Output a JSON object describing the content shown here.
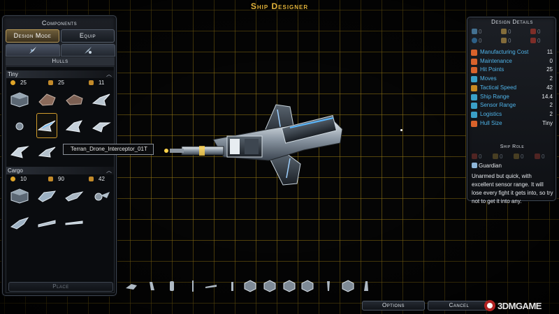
{
  "title": "Ship Designer",
  "components": {
    "header": "Components",
    "tabs": {
      "design_mode": "Design Mode",
      "equip": "Equip"
    },
    "section_label": "Hulls",
    "categories": [
      {
        "name": "Tiny",
        "stats": {
          "cost": "25",
          "capacity": "25",
          "speed": "11"
        }
      },
      {
        "name": "Cargo",
        "stats": {
          "cost": "10",
          "capacity": "90",
          "speed": "42"
        }
      }
    ],
    "tooltip": "Terran_Drone_Interceptor_01T",
    "place_label": "Place"
  },
  "design_details": {
    "header": "Design Details",
    "weapons": [
      "0",
      "0",
      "0",
      "0",
      "0",
      "0"
    ],
    "stats": [
      {
        "label": "Manufacturing Cost",
        "value": "11",
        "icon": "cost-icon",
        "color": "#d9622b"
      },
      {
        "label": "Maintenance",
        "value": "0",
        "icon": "maintenance-icon",
        "color": "#d9622b"
      },
      {
        "label": "Hit Points",
        "value": "25",
        "icon": "hit-points-icon",
        "color": "#d9622b"
      },
      {
        "label": "Moves",
        "value": "2",
        "icon": "moves-icon",
        "color": "#3aa0c8"
      },
      {
        "label": "Tactical Speed",
        "value": "42",
        "icon": "tactical-speed-icon",
        "color": "#c98a22"
      },
      {
        "label": "Ship Range",
        "value": "14.4",
        "icon": "ship-range-icon",
        "color": "#3aa0c8"
      },
      {
        "label": "Sensor Range",
        "value": "2",
        "icon": "sensor-range-icon",
        "color": "#3aa0c8"
      },
      {
        "label": "Logistics",
        "value": "2",
        "icon": "logistics-icon",
        "color": "#3aa0c8"
      },
      {
        "label": "Hull Size",
        "value": "Tiny",
        "icon": "hull-size-icon",
        "color": "#d9622b"
      }
    ],
    "ship_role_header": "Ship Role",
    "role_values": [
      "0",
      "0",
      "0",
      "0"
    ],
    "role_name": "Guardian",
    "role_description": "Unarmed but quick, with excellent sensor range. It will lose every fight it gets into, so try not to get it into any."
  },
  "bottom": {
    "options_label": "Options",
    "cancel_label": "Cancel"
  },
  "watermark": "3DMGAME",
  "colors": {
    "accent": "#e2b33a",
    "label_blue": "#4fb3e8",
    "grid": "#96781a"
  }
}
